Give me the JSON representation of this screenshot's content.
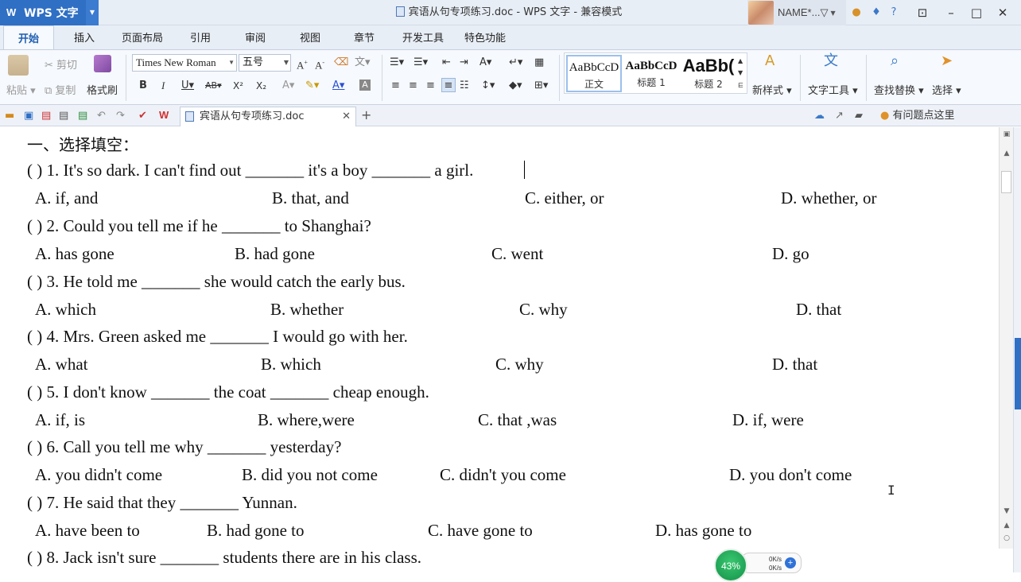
{
  "titlebar": {
    "app_name": "WPS 文字",
    "doc_title": "宾语从句专项练习.doc - WPS 文字 - 兼容模式",
    "user_name": "NAME*...",
    "user_suffix": "▽"
  },
  "ribbon_tabs": [
    "开始",
    "插入",
    "页面布局",
    "引用",
    "审阅",
    "视图",
    "章节",
    "开发工具",
    "特色功能"
  ],
  "ribbon": {
    "paste": "粘贴",
    "cut": "剪切",
    "copy": "复制",
    "format_painter": "格式刷",
    "font_name": "Times New Roman",
    "font_size": "五号",
    "styles": [
      {
        "preview": "AaBbCcD",
        "label": "正文"
      },
      {
        "preview": "AaBbCcD",
        "label": "标题 1"
      },
      {
        "preview": "AaBb(",
        "label": "标题 2"
      }
    ],
    "new_style": "新样式",
    "text_tools": "文字工具",
    "find_replace": "查找替换",
    "select": "选择"
  },
  "quick_access": {
    "doc_tab": "宾语从句专项练习.doc",
    "help": "有问题点这里"
  },
  "document": {
    "heading": "一、选择填空：",
    "questions": [
      {
        "text": "( ) 1. It's so dark. I can't find out _______ it's a boy _______ a girl.",
        "options": [
          "A. if, and",
          "B. that, and",
          "C. either, or",
          "D. whether, or"
        ]
      },
      {
        "text": "( ) 2. Could you tell me if he _______ to Shanghai?",
        "options": [
          "A. has gone",
          "B. had gone",
          "C. went",
          "D. go"
        ]
      },
      {
        "text": "( ) 3. He told me _______ she would catch the early bus.",
        "options": [
          "A. which",
          "B. whether",
          "C. why",
          "D. that"
        ]
      },
      {
        "text": "( ) 4. Mrs. Green asked me _______ I would go with her.",
        "options": [
          "A. what",
          "B. which",
          "C. why",
          "D. that"
        ]
      },
      {
        "text": "( ) 5. I don't know _______ the coat _______ cheap enough.",
        "options": [
          "A. if, is",
          "B. where,were",
          "C. that ,was",
          "D. if, were"
        ]
      },
      {
        "text": "( ) 6. Call you tell me why _______ yesterday?",
        "options": [
          "A. you didn't come",
          "B. did you not come",
          "C. didn't you come",
          "D. you don't come"
        ]
      },
      {
        "text": "( ) 7. He said that they _______ Yunnan.",
        "options": [
          "A. have been to",
          "B. had gone to",
          "C. have gone to",
          "D. has gone to"
        ]
      },
      {
        "text": "( ) 8. Jack isn't sure _______ students there are in his class.",
        "options": []
      }
    ]
  },
  "net_widget": {
    "percent": "43%",
    "up": "0K/s",
    "down": "0K/s"
  }
}
